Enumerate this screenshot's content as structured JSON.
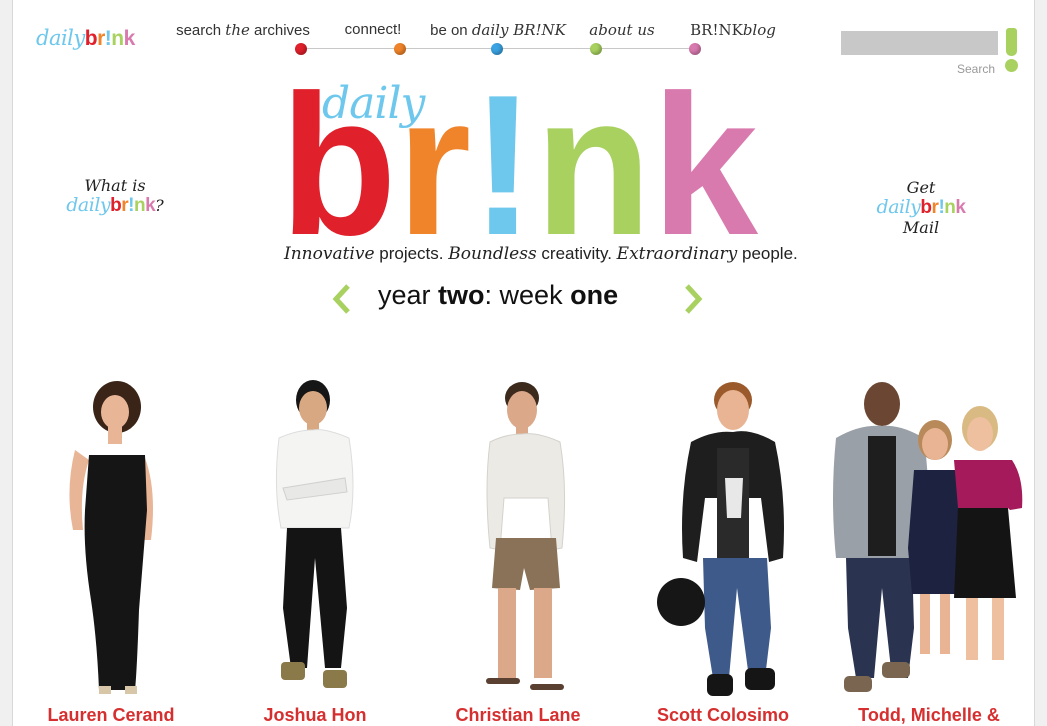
{
  "brand": {
    "small_logo_daily": "daily",
    "small_logo_brink": [
      "b",
      "r",
      "!",
      "n",
      "k"
    ],
    "big_daily": "daily",
    "big_brink": [
      "b",
      "r",
      "!",
      "n",
      "k"
    ],
    "colors": {
      "red": "#e0202b",
      "orange": "#f0842a",
      "blue": "#6ec7ec",
      "green": "#a8d160",
      "pink": "#d97aaf",
      "name_red": "#d62f2f"
    }
  },
  "nav": [
    {
      "pre": "search ",
      "em": "the",
      "post": " archives",
      "dot_color": "#e0202b"
    },
    {
      "pre": "connect!",
      "em": "",
      "post": "",
      "dot_color": "#f0842a"
    },
    {
      "pre": "be on ",
      "em": "daily BR!NK",
      "post": "",
      "dot_color": "#3aa3e3"
    },
    {
      "pre": "",
      "em": "about us",
      "post": "",
      "dot_color": "#a8d160"
    },
    {
      "pre": "BR!NK",
      "em": "blog",
      "post": "",
      "dot_color": "#d97aaf"
    }
  ],
  "search": {
    "label": "Search",
    "placeholder": ""
  },
  "tagline": {
    "p1": "Innovative",
    "p2": " projects. ",
    "p3": "Boundless",
    "p4": " creativity. ",
    "p5": "Extraordinary",
    "p6": " people."
  },
  "week": {
    "w1": "year ",
    "w2": "two",
    "w3": ": week ",
    "w4": "one"
  },
  "side_left": {
    "line1": "What is",
    "daily": "daily",
    "brink": [
      "b",
      "r",
      "!",
      "n",
      "k"
    ],
    "suffix": "?"
  },
  "side_right": {
    "line1": "Get",
    "daily": "daily",
    "brink": [
      "b",
      "r",
      "!",
      "n",
      "k"
    ],
    "line3": "Mail"
  },
  "people": [
    {
      "name": "Lauren Cerand"
    },
    {
      "name": "Joshua Hon"
    },
    {
      "name": "Christian Lane"
    },
    {
      "name": "Scott Colosimo"
    },
    {
      "name": "Todd, Michelle &"
    }
  ]
}
